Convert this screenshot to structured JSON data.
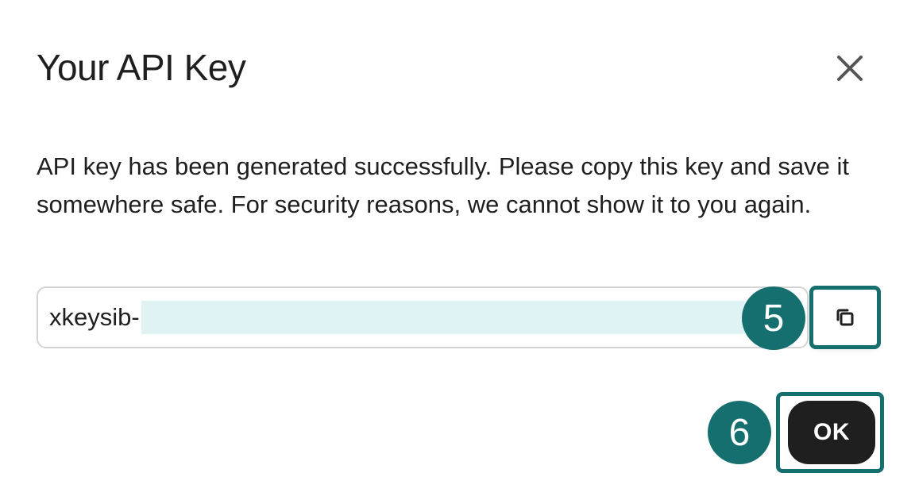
{
  "dialog": {
    "title": "Your API Key",
    "message": "API key has been generated successfully. Please copy this key and save it somewhere safe. For security reasons, we cannot show it to you again.",
    "close_icon": "close-icon"
  },
  "api_key": {
    "visible_prefix": "xkeysib-"
  },
  "copy_button": {
    "icon": "copy-icon"
  },
  "ok_button": {
    "label": "OK"
  },
  "annotations": {
    "step_copy": "5",
    "step_ok": "6"
  },
  "colors": {
    "accent": "#156f6f",
    "masked_key": "#dff3f4",
    "primary_button": "#1f1f1f",
    "text": "#1f1f1f",
    "field_border": "#d4d4d4"
  }
}
